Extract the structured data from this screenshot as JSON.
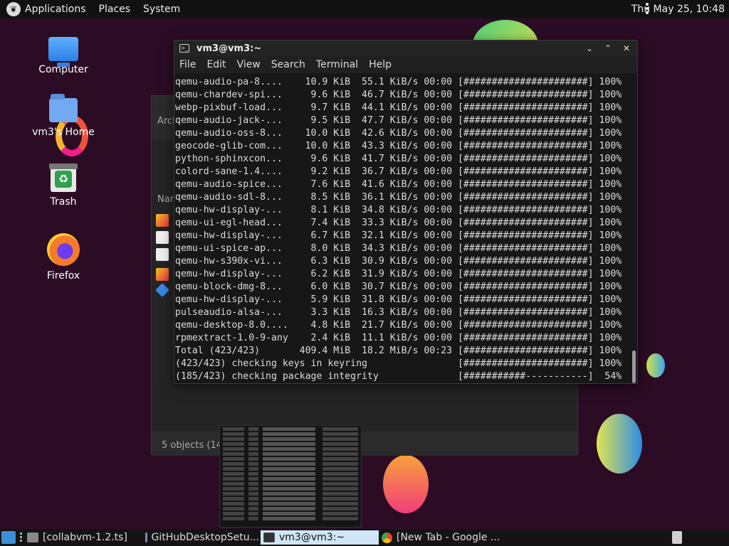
{
  "topbar": {
    "menus": [
      "Applications",
      "Places",
      "System"
    ],
    "clock": "Thu May 25, 10:48"
  },
  "desktop": {
    "icons": [
      {
        "label": "Computer",
        "icon": "computer-icon"
      },
      {
        "label": "vm3's Home",
        "icon": "home-folder-icon"
      },
      {
        "label": "Trash",
        "icon": "trash-icon"
      },
      {
        "label": "Firefox",
        "icon": "firefox-icon"
      }
    ]
  },
  "file_manager": {
    "title_fragment": "Arch",
    "column_header_fragment": "Nam",
    "status": "5 objects (141"
  },
  "terminal": {
    "title": "vm3@vm3:~",
    "menus": [
      "File",
      "Edit",
      "View",
      "Search",
      "Terminal",
      "Help"
    ],
    "lines": [
      "qemu-audio-pa-8....    10.9 KiB  55.1 KiB/s 00:00 [######################] 100%",
      "qemu-chardev-spi...     9.6 KiB  46.7 KiB/s 00:00 [######################] 100%",
      "webp-pixbuf-load...     9.7 KiB  44.1 KiB/s 00:00 [######################] 100%",
      "qemu-audio-jack-...     9.5 KiB  47.7 KiB/s 00:00 [######################] 100%",
      "qemu-audio-oss-8...    10.0 KiB  42.6 KiB/s 00:00 [######################] 100%",
      "geocode-glib-com...    10.0 KiB  43.3 KiB/s 00:00 [######################] 100%",
      "python-sphinxcon...     9.6 KiB  41.7 KiB/s 00:00 [######################] 100%",
      "colord-sane-1.4....     9.2 KiB  36.7 KiB/s 00:00 [######################] 100%",
      "qemu-audio-spice...     7.6 KiB  41.6 KiB/s 00:00 [######################] 100%",
      "qemu-audio-sdl-8...     8.5 KiB  36.1 KiB/s 00:00 [######################] 100%",
      "qemu-hw-display-...     8.1 KiB  34.8 KiB/s 00:00 [######################] 100%",
      "qemu-ui-egl-head...     7.4 KiB  33.3 KiB/s 00:00 [######################] 100%",
      "qemu-hw-display-...     6.7 KiB  32.1 KiB/s 00:00 [######################] 100%",
      "qemu-ui-spice-ap...     8.0 KiB  34.3 KiB/s 00:00 [######################] 100%",
      "qemu-hw-s390x-vi...     6.3 KiB  30.9 KiB/s 00:00 [######################] 100%",
      "qemu-hw-display-...     6.2 KiB  31.9 KiB/s 00:00 [######################] 100%",
      "qemu-block-dmg-8...     6.0 KiB  30.7 KiB/s 00:00 [######################] 100%",
      "qemu-hw-display-...     5.9 KiB  31.8 KiB/s 00:00 [######################] 100%",
      "pulseaudio-alsa-...     3.3 KiB  16.3 KiB/s 00:00 [######################] 100%",
      "qemu-desktop-8.0....    4.8 KiB  21.7 KiB/s 00:00 [######################] 100%",
      "rpmextract-1.0-9-any    2.4 KiB  11.1 KiB/s 00:00 [######################] 100%",
      "Total (423/423)       409.4 MiB  18.2 MiB/s 00:23 [######################] 100%",
      "(423/423) checking keys in keyring                [######################] 100%",
      "(185/423) checking package integrity              [###########-----------]  54%"
    ]
  },
  "taskbar": {
    "items": [
      {
        "label": "[collabvm-1.2.ts]",
        "active": false
      },
      {
        "label": "GitHubDesktopSetu...",
        "active": false
      },
      {
        "label": "vm3@vm3:~",
        "active": true
      },
      {
        "label": "[New Tab - Google ...",
        "active": false
      }
    ]
  },
  "colors": {
    "desktop_bg": "#2c0c24",
    "taskbar_active": "#cfe6f7"
  }
}
